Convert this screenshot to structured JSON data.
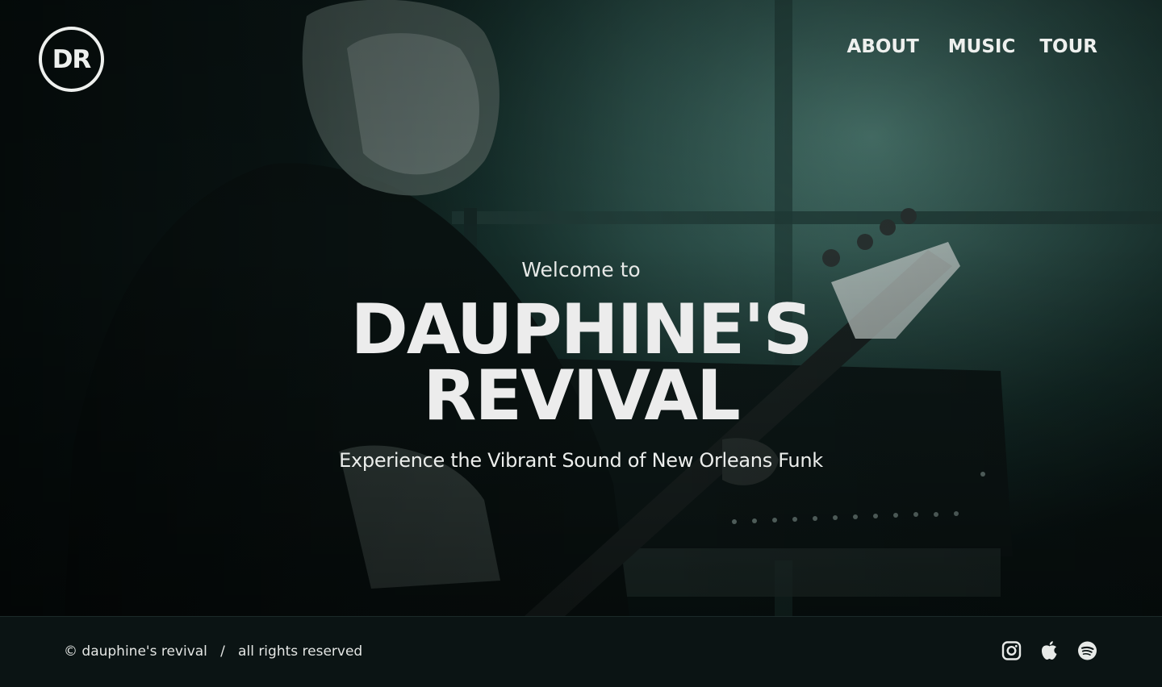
{
  "brand": {
    "logo_text": "DR"
  },
  "nav": {
    "items": [
      {
        "label": "ABOUT"
      },
      {
        "label": "MUSIC"
      },
      {
        "label": "TOUR"
      }
    ]
  },
  "hero": {
    "welcome": "Welcome to",
    "title_line1": "DAUPHINE'S",
    "title_line2": "REVIVAL",
    "tagline": "Experience the Vibrant Sound of New Orleans Funk",
    "image": "band-member-playing-bass-guitar-photo"
  },
  "footer": {
    "copyright": "© dauphine's revival   /   all rights reserved",
    "socials": [
      {
        "icon": "instagram-icon"
      },
      {
        "icon": "apple-music-icon"
      },
      {
        "icon": "spotify-icon"
      }
    ]
  },
  "colors": {
    "background": "#0b1414",
    "text": "#ececec",
    "hero_tint": "#4d7b72"
  }
}
